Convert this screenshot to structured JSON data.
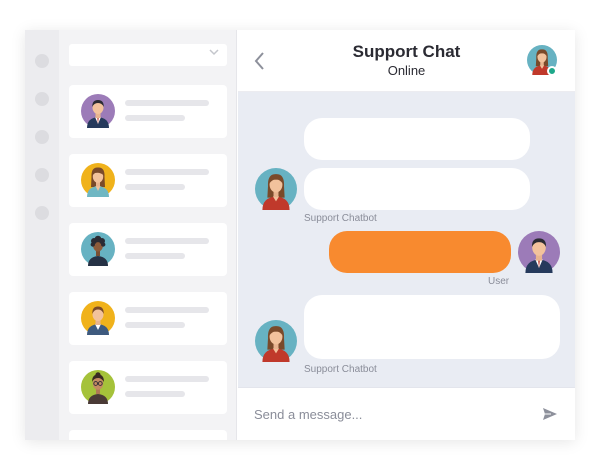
{
  "chat": {
    "title": "Support Chat",
    "status": "Online",
    "composer_placeholder": "Send a message...",
    "messages": [
      {
        "sender": "bot",
        "label": ""
      },
      {
        "sender": "bot",
        "label": "Support Chatbot"
      },
      {
        "sender": "user",
        "label": "User"
      },
      {
        "sender": "bot",
        "label": "Support Chatbot"
      }
    ]
  },
  "contacts": [
    {
      "avatar_bg": "#9c7bb8"
    },
    {
      "avatar_bg": "#f0b21b"
    },
    {
      "avatar_bg": "#67b2c2"
    },
    {
      "avatar_bg": "#f0b21b"
    },
    {
      "avatar_bg": "#a5c23a"
    }
  ],
  "colors": {
    "accent_orange": "#f88a2f",
    "online_green": "#1ea88a",
    "chat_background": "#e9ecf3"
  },
  "icons": {
    "back": "chevron-left-icon",
    "send": "send-icon",
    "dropdown": "chevron-down-icon"
  }
}
